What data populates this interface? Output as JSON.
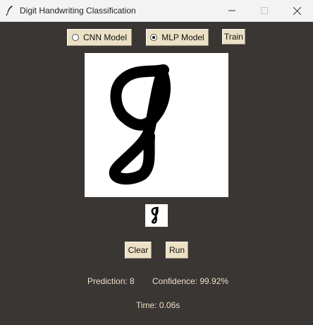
{
  "window": {
    "title": "Digit Handwriting Classification",
    "icon": "feather-icon"
  },
  "controls": {
    "models": [
      {
        "label": "CNN Model",
        "selected": false
      },
      {
        "label": "MLP Model",
        "selected": true
      }
    ],
    "train_label": "Train",
    "clear_label": "Clear",
    "run_label": "Run"
  },
  "results": {
    "prediction": "Prediction: 8",
    "confidence": "Confidence: 99.92%",
    "time": "Time: 0.06s"
  },
  "colors": {
    "background": "#3a3634",
    "button": "#ece0c5",
    "label_text": "#ecdfc4"
  }
}
